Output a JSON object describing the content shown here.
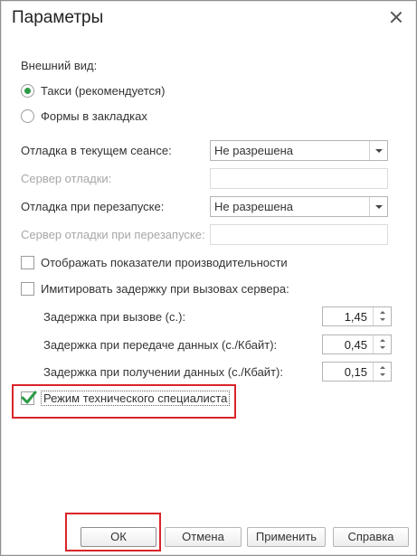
{
  "window": {
    "title": "Параметры"
  },
  "appearance": {
    "label": "Внешний вид:",
    "options": [
      {
        "label": "Такси (рекомендуется)",
        "checked": true
      },
      {
        "label": "Формы в закладках",
        "checked": false
      }
    ]
  },
  "debug": {
    "current_session_label": "Отладка в текущем сеансе:",
    "current_session_value": "Не разрешена",
    "server_label": "Сервер отладки:",
    "restart_label": "Отладка при перезапуске:",
    "restart_value": "Не разрешена",
    "restart_server_label": "Сервер отладки при перезапуске:"
  },
  "checkboxes": {
    "performance": {
      "label": "Отображать показатели производительности",
      "checked": false
    },
    "simulate_delay": {
      "label": "Имитировать задержку при вызовах сервера:",
      "checked": false
    },
    "tech_specialist": {
      "label": "Режим технического специалиста",
      "checked": true
    }
  },
  "delays": [
    {
      "label": "Задержка при вызове (с.):",
      "value": "1,45"
    },
    {
      "label": "Задержка при передаче данных (с./Кбайт):",
      "value": "0,45"
    },
    {
      "label": "Задержка при получении данных (с./Кбайт):",
      "value": "0,15"
    }
  ],
  "buttons": {
    "ok": "ОК",
    "cancel": "Отмена",
    "apply": "Применить",
    "help": "Справка"
  },
  "colors": {
    "accent_green": "#2d9b45",
    "highlight_red": "#d9242a"
  },
  "icons": {
    "close": "close-icon",
    "dropdown": "chevron-down-icon",
    "spinner": "spinner-arrows-icon",
    "checkmark": "checkmark-icon"
  }
}
